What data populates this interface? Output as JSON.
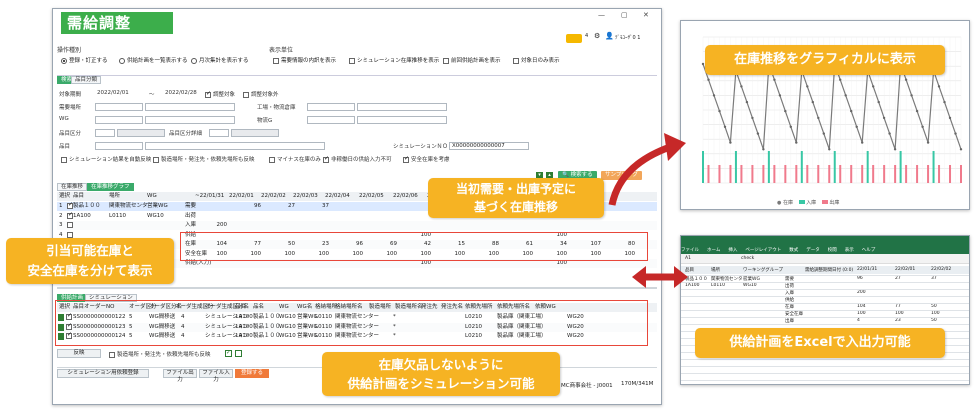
{
  "app": {
    "title": "需給調整",
    "user_badge": "4",
    "user_name": "ﾃﾞﾓﾕｰｻﾞ0 1",
    "win_min": "—",
    "win_max": "▢",
    "win_close": "✕"
  },
  "options": {
    "operation_label": "操作種別",
    "display_label": "表示単位",
    "radios": [
      "登録・訂正する",
      "供給計画を一覧表示する",
      "月次集計を表示する"
    ],
    "checks": [
      "需要情報の内訳を表示",
      "シミュレーション在庫推移を表示",
      "前回供給計画を表示",
      "対象日のみ表示"
    ]
  },
  "search": {
    "tabs": [
      "検索",
      "品目分類"
    ],
    "period_label": "対象期間",
    "date_from": "2022/02/01",
    "tilde": "～",
    "date_to": "2022/02/28",
    "adjust_target": "調整対象",
    "adjust_exclude": "調整対象外",
    "demand_place": "需要場所",
    "factory": "工場・物流倉庫",
    "wg": "WG",
    "logistics_wg": "物流G",
    "item_class": "品目区分",
    "item_class_detail": "品目区分詳細",
    "item": "品目",
    "sim_no_label": "シミュレーションＮＯ",
    "sim_no_value": "X00000000000007",
    "checks": [
      "シミュレーション結果を自動反映",
      "製造場所・発注先・依頼先場所も反映",
      "マイナス在庫のみ",
      "非稼働日の供給入力不可",
      "安全在庫を考慮"
    ],
    "search_button": "検索する",
    "sample_button": "サンプリング"
  },
  "stock_grid": {
    "tabs": [
      "在庫推移",
      "在庫推移グラフ"
    ],
    "headers": [
      "選択",
      "品目",
      "場所",
      "WG",
      "",
      "~22/01/31",
      "22/02/01",
      "22/02/02",
      "22/02/03",
      "22/02/04",
      "22/02/05",
      "22/02/06",
      "22/02/07",
      "22/02/08",
      "22/02/09",
      "22/02/10",
      "22/02/11"
    ],
    "rows": [
      {
        "no": "1",
        "item": "製品１００",
        "place": "関東物流センター",
        "wg": "営業WG",
        "kind": "需要",
        "vals": [
          "",
          "96",
          "27",
          "37",
          "",
          "",
          "",
          "",
          "",
          "",
          "",
          ""
        ]
      },
      {
        "no": "2",
        "item": "1A100",
        "place": "L0110",
        "wg": "WG10",
        "kind": "出荷",
        "vals": [
          "",
          "",
          "",
          "",
          "",
          "",
          "",
          "",
          "",
          "",
          "",
          ""
        ]
      },
      {
        "no": "3",
        "item": "",
        "place": "",
        "wg": "",
        "kind": "入庫",
        "vals": [
          "200",
          "",
          "",
          "",
          "",
          "",
          "",
          "",
          "",
          "",
          "",
          ""
        ]
      },
      {
        "no": "4",
        "item": "",
        "place": "",
        "wg": "",
        "kind": "供給",
        "vals": [
          "",
          "",
          "",
          "",
          "",
          "",
          "100",
          "",
          "",
          "",
          "100",
          ""
        ]
      },
      {
        "no": "",
        "item": "",
        "place": "",
        "wg": "",
        "kind": "在庫",
        "vals": [
          "104",
          "77",
          "50",
          "23",
          "96",
          "69",
          "42",
          "15",
          "88",
          "61",
          "34",
          "107",
          "80"
        ]
      },
      {
        "no": "",
        "item": "",
        "place": "",
        "wg": "",
        "kind": "安全在庫",
        "vals": [
          "100",
          "100",
          "100",
          "100",
          "100",
          "100",
          "100",
          "100",
          "100",
          "100",
          "100",
          "100",
          "100"
        ]
      },
      {
        "no": "",
        "item": "",
        "place": "",
        "wg": "",
        "kind": "供給(入力)",
        "vals": [
          "",
          "",
          "",
          "",
          "",
          "",
          "100",
          "",
          "",
          "",
          "100",
          ""
        ]
      }
    ]
  },
  "supply_grid": {
    "tabs": [
      "供給計画",
      "シミュレーション"
    ],
    "headers": [
      "選択",
      "品目オーダーNO",
      "オーダ区分",
      "オーダ区分名",
      "オーダ生成区分",
      "オーダ生成区分名",
      "品目",
      "品名",
      "WG",
      "WG名",
      "格納場所",
      "格納場所名",
      "製造場所",
      "製造場所名",
      "発注先",
      "発注先名",
      "依頼先場所",
      "依頼先場所名",
      "依頼WG"
    ],
    "rows": [
      {
        "order": "SS0000000000122",
        "cls": "5",
        "cls_name": "WG間移送",
        "gen": "4",
        "gen_name": "シミュレーション",
        "item": "1A100",
        "name": "製品１００",
        "wg": "WG10",
        "wg_name": "営業WG",
        "store": "L0110",
        "store_name": "関東物流センター",
        "mfg": "*",
        "req": "L0210",
        "req_name": "製品庫（関東工場）",
        "req_wg": "WG20"
      },
      {
        "order": "SS0000000000123",
        "cls": "5",
        "cls_name": "WG間移送",
        "gen": "4",
        "gen_name": "シミュレーション",
        "item": "1A100",
        "name": "製品１００",
        "wg": "WG10",
        "wg_name": "営業WG",
        "store": "L0110",
        "store_name": "関東物流センター",
        "mfg": "*",
        "req": "L0210",
        "req_name": "製品庫（関東工場）",
        "req_wg": "WG20"
      },
      {
        "order": "SS0000000000124",
        "cls": "5",
        "cls_name": "WG間移送",
        "gen": "4",
        "gen_name": "シミュレーション",
        "item": "1A100",
        "name": "製品１００",
        "wg": "WG10",
        "wg_name": "営業WG",
        "store": "L0110",
        "store_name": "関東物流センター",
        "mfg": "*",
        "req": "L0210",
        "req_name": "製品庫（関東工場）",
        "req_wg": "WG20"
      }
    ],
    "reflect_button": "反映",
    "reflect_check": "製造場所・発注先・依頼先場所も反映"
  },
  "footer": {
    "sim_register": "シミュレーション用依頼登録",
    "file_out": "ファイル出力",
    "file_in": "ファイル入力",
    "register": "登録する",
    "company": "MC商事会社 - J0001",
    "memory": "170M/341M"
  },
  "callouts": {
    "chart": "在庫推移をグラフィカルに表示",
    "demand": [
      "当初需要・出庫予定に",
      "基づく在庫推移"
    ],
    "safety": [
      "引当可能在庫と",
      "安全在庫を分けて表示"
    ],
    "shortage": [
      "在庫欠品しないように",
      "供給計画をシミュレーション可能"
    ],
    "excel": "供給計画をExcelで入出力可能"
  },
  "chart_window": {
    "legend": [
      "在庫",
      "入庫",
      "出庫"
    ],
    "colors": {
      "line": "#7a7a7a",
      "in": "#38c7a5",
      "out": "#f07a8c"
    }
  },
  "excel": {
    "ribbon": [
      "ファイル",
      "ホーム",
      "挿入",
      "ページレイアウト",
      "数式",
      "データ",
      "校閲",
      "表示",
      "ヘルプ"
    ],
    "formula_cell": "A1",
    "formula_value": "check",
    "header_row": [
      "品目",
      "場所",
      "ワーキンググループ",
      "",
      "需給調整期間日付 (0:0)",
      "22/01/31",
      "22/02/01",
      "22/02/02"
    ],
    "rows": [
      [
        "製品１００",
        "関東物流センター",
        "営業WG",
        "需要",
        "",
        "96",
        "27",
        "37"
      ],
      [
        "1A100",
        "L0110",
        "WG10",
        "出荷",
        "",
        "",
        "",
        ""
      ],
      [
        "",
        "",
        "",
        "入庫",
        "",
        "200",
        "",
        ""
      ],
      [
        "",
        "",
        "",
        "供給",
        "",
        "",
        "",
        ""
      ],
      [
        "",
        "",
        "",
        "在庫",
        "",
        "104",
        "77",
        "50"
      ],
      [
        "",
        "",
        "",
        "安全在庫",
        "",
        "100",
        "100",
        "100"
      ],
      [
        "",
        "",
        "",
        "出庫",
        "",
        "4",
        "23",
        "50"
      ]
    ]
  }
}
